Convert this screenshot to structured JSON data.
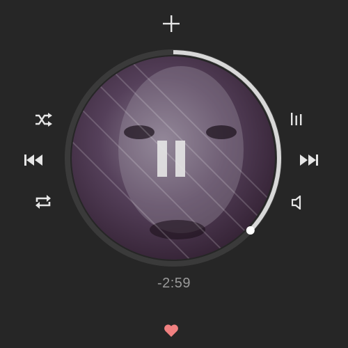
{
  "player": {
    "remaining_time": "-2:59",
    "progress": 0.37,
    "state": "playing",
    "artwork": "portrait-artwork"
  },
  "controls": {
    "add": "plus-icon",
    "shuffle": "shuffle-icon",
    "previous": "previous-track-icon",
    "repeat": "repeat-icon",
    "queue": "queue-icon",
    "next": "next-track-icon",
    "volume": "volume-icon",
    "pause": "pause-icon",
    "like": "heart-icon"
  },
  "colors": {
    "background": "#262626",
    "ring_track": "#3a3a3a",
    "ring_progress": "#d8d8d8",
    "icon": "#e6e6e6",
    "heart": "#f08080",
    "artwork_tint": "#3a2436"
  }
}
